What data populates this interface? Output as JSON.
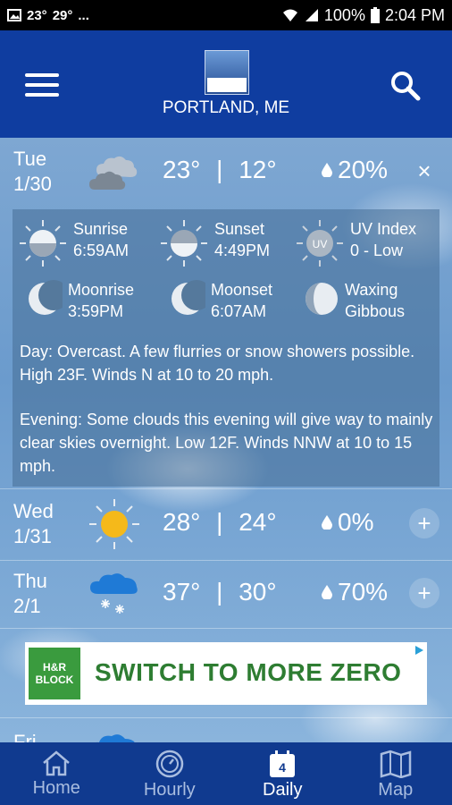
{
  "status_bar": {
    "temp_low": "23°",
    "temp_high": "29°",
    "more": "...",
    "battery": "100%",
    "time": "2:04 PM"
  },
  "header": {
    "location": "PORTLAND, ME"
  },
  "days": [
    {
      "day": "Tue",
      "date": "1/30",
      "icon": "cloudy-icon",
      "high": "23°",
      "low": "12°",
      "separator": "|",
      "precip": "20%",
      "toggle": "×",
      "expanded": true
    },
    {
      "day": "Wed",
      "date": "1/31",
      "icon": "sun-icon",
      "high": "28°",
      "low": "24°",
      "separator": "|",
      "precip": "0%",
      "toggle": "+"
    },
    {
      "day": "Thu",
      "date": "2/1",
      "icon": "snow-icon",
      "high": "37°",
      "low": "30°",
      "separator": "|",
      "precip": "70%",
      "toggle": "+"
    },
    {
      "day": "Fri",
      "icon": "cloud-icon"
    }
  ],
  "details": {
    "sunrise_label": "Sunrise",
    "sunrise_value": "6:59AM",
    "sunset_label": "Sunset",
    "sunset_value": "4:49PM",
    "uv_label": "UV Index",
    "uv_value": "0 - Low",
    "uv_icon_text": "UV",
    "moonrise_label": "Moonrise",
    "moonrise_value": "3:59PM",
    "moonset_label": "Moonset",
    "moonset_value": "6:07AM",
    "phase_line1": "Waxing",
    "phase_line2": "Gibbous",
    "day_text": "Day: Overcast. A few flurries or snow showers possible. High 23F. Winds N at 10 to 20 mph.",
    "evening_text": "Evening: Some clouds this evening will give way to mainly clear skies overnight. Low 12F. Winds NNW at 10 to 15 mph."
  },
  "ad": {
    "brand": "H&R BLOCK",
    "headline": "SWITCH TO MORE ZERO"
  },
  "nav": {
    "home": "Home",
    "hourly": "Hourly",
    "daily": "Daily",
    "daily_badge": "4",
    "map": "Map"
  },
  "colors": {
    "header_bg": "#0f3da0",
    "nav_bg": "#103a8f",
    "sun": "#f5b91a",
    "rain_cloud": "#1f7ad6",
    "ad_green": "#2e7d32"
  }
}
